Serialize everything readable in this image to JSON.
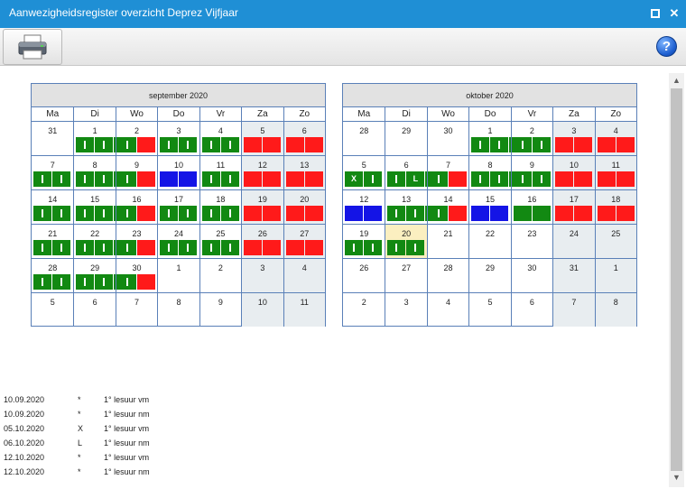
{
  "window": {
    "title": "Aanwezigheidsregister overzicht Deprez Vijfjaar",
    "close_label": "✕"
  },
  "toolbar": {
    "help_label": "?"
  },
  "day_headers": [
    "Ma",
    "Di",
    "Wo",
    "Do",
    "Vr",
    "Za",
    "Zo"
  ],
  "calendars": [
    {
      "title": "september 2020",
      "weeks": [
        [
          {
            "d": "31",
            "b": []
          },
          {
            "d": "1",
            "b": [
              "g",
              "g",
              "g"
            ]
          },
          {
            "d": "2",
            "b": [
              "g",
              "r"
            ]
          },
          {
            "d": "3",
            "b": [
              "g",
              "g"
            ]
          },
          {
            "d": "4",
            "b": [
              "g",
              "g"
            ]
          },
          {
            "d": "5",
            "w": 1,
            "b": [
              "r",
              "r"
            ]
          },
          {
            "d": "6",
            "w": 1,
            "b": [
              "r",
              "r"
            ]
          }
        ],
        [
          {
            "d": "7",
            "b": [
              "g",
              "g"
            ]
          },
          {
            "d": "8",
            "b": [
              "g",
              "g",
              "g"
            ]
          },
          {
            "d": "9",
            "b": [
              "g",
              "r"
            ]
          },
          {
            "d": "10",
            "b": [
              "b",
              "b"
            ]
          },
          {
            "d": "11",
            "b": [
              "g",
              "g"
            ]
          },
          {
            "d": "12",
            "w": 1,
            "b": [
              "r",
              "r"
            ]
          },
          {
            "d": "13",
            "w": 1,
            "b": [
              "r",
              "r"
            ]
          }
        ],
        [
          {
            "d": "14",
            "b": [
              "g",
              "g"
            ]
          },
          {
            "d": "15",
            "b": [
              "g",
              "g",
              "g"
            ]
          },
          {
            "d": "16",
            "b": [
              "g",
              "r"
            ]
          },
          {
            "d": "17",
            "b": [
              "g",
              "g"
            ]
          },
          {
            "d": "18",
            "b": [
              "g",
              "g"
            ]
          },
          {
            "d": "19",
            "w": 1,
            "b": [
              "r",
              "r"
            ]
          },
          {
            "d": "20",
            "w": 1,
            "b": [
              "r",
              "r"
            ]
          }
        ],
        [
          {
            "d": "21",
            "b": [
              "g",
              "g"
            ]
          },
          {
            "d": "22",
            "b": [
              "g",
              "g",
              "g"
            ]
          },
          {
            "d": "23",
            "b": [
              "g",
              "r"
            ]
          },
          {
            "d": "24",
            "b": [
              "g",
              "g"
            ]
          },
          {
            "d": "25",
            "b": [
              "g",
              "g"
            ]
          },
          {
            "d": "26",
            "w": 1,
            "b": [
              "r",
              "r"
            ]
          },
          {
            "d": "27",
            "w": 1,
            "b": [
              "r",
              "r"
            ]
          }
        ],
        [
          {
            "d": "28",
            "b": [
              "g",
              "g"
            ]
          },
          {
            "d": "29",
            "b": [
              "g",
              "g",
              "g"
            ]
          },
          {
            "d": "30",
            "b": [
              "g",
              "r"
            ]
          },
          {
            "d": "1",
            "b": []
          },
          {
            "d": "2",
            "b": []
          },
          {
            "d": "3",
            "w": 1,
            "b": []
          },
          {
            "d": "4",
            "w": 1,
            "b": []
          }
        ],
        [
          {
            "d": "5",
            "b": []
          },
          {
            "d": "6",
            "b": []
          },
          {
            "d": "7",
            "b": []
          },
          {
            "d": "8",
            "b": []
          },
          {
            "d": "9",
            "b": []
          },
          {
            "d": "10",
            "w": 1,
            "b": []
          },
          {
            "d": "11",
            "w": 1,
            "b": []
          }
        ]
      ]
    },
    {
      "title": "oktober 2020",
      "weeks": [
        [
          {
            "d": "28",
            "b": []
          },
          {
            "d": "29",
            "b": []
          },
          {
            "d": "30",
            "b": []
          },
          {
            "d": "1",
            "b": [
              "g",
              "g",
              "g"
            ]
          },
          {
            "d": "2",
            "b": [
              "g",
              "g"
            ]
          },
          {
            "d": "3",
            "w": 1,
            "b": [
              "r",
              "r"
            ]
          },
          {
            "d": "4",
            "w": 1,
            "b": [
              "r",
              "r"
            ]
          }
        ],
        [
          {
            "d": "5",
            "b": [
              "X",
              "g"
            ]
          },
          {
            "d": "6",
            "b": [
              "g",
              "L",
              "g"
            ]
          },
          {
            "d": "7",
            "b": [
              "g",
              "r"
            ]
          },
          {
            "d": "8",
            "b": [
              "g",
              "g",
              "g"
            ]
          },
          {
            "d": "9",
            "b": [
              "g",
              "g"
            ]
          },
          {
            "d": "10",
            "w": 1,
            "b": [
              "r",
              "r"
            ]
          },
          {
            "d": "11",
            "w": 1,
            "b": [
              "r",
              "r"
            ]
          }
        ],
        [
          {
            "d": "12",
            "b": [
              "b",
              "b"
            ]
          },
          {
            "d": "13",
            "b": [
              "g",
              "g",
              "g"
            ]
          },
          {
            "d": "14",
            "b": [
              "g",
              "r"
            ]
          },
          {
            "d": "15",
            "b": [
              "b",
              "b"
            ]
          },
          {
            "d": "16",
            "b": [
              "G",
              "G"
            ]
          },
          {
            "d": "17",
            "w": 1,
            "b": [
              "r",
              "r"
            ]
          },
          {
            "d": "18",
            "w": 1,
            "b": [
              "r",
              "r"
            ]
          }
        ],
        [
          {
            "d": "19",
            "b": [
              "g",
              "g"
            ]
          },
          {
            "d": "20",
            "t": 1,
            "b": [
              "g",
              "g"
            ]
          },
          {
            "d": "21",
            "b": []
          },
          {
            "d": "22",
            "b": []
          },
          {
            "d": "23",
            "b": []
          },
          {
            "d": "24",
            "w": 1,
            "b": []
          },
          {
            "d": "25",
            "w": 1,
            "b": []
          }
        ],
        [
          {
            "d": "26",
            "b": []
          },
          {
            "d": "27",
            "b": []
          },
          {
            "d": "28",
            "b": []
          },
          {
            "d": "29",
            "b": []
          },
          {
            "d": "30",
            "b": []
          },
          {
            "d": "31",
            "w": 1,
            "b": []
          },
          {
            "d": "1",
            "w": 1,
            "b": []
          }
        ],
        [
          {
            "d": "2",
            "b": []
          },
          {
            "d": "3",
            "b": []
          },
          {
            "d": "4",
            "b": []
          },
          {
            "d": "5",
            "b": []
          },
          {
            "d": "6",
            "b": []
          },
          {
            "d": "7",
            "w": 1,
            "b": []
          },
          {
            "d": "8",
            "w": 1,
            "b": []
          }
        ]
      ]
    }
  ],
  "status_colors": {
    "present": "#128912",
    "absent": "#ff1a1a",
    "other": "#1414e6",
    "weekend": "#e8edf0",
    "today": "#fbefc0"
  },
  "entries": [
    {
      "date": "10.09.2020",
      "code": "*",
      "desc": "1° lesuur vm"
    },
    {
      "date": "10.09.2020",
      "code": "*",
      "desc": "1° lesuur nm"
    },
    {
      "date": "05.10.2020",
      "code": "X",
      "desc": "1° lesuur vm"
    },
    {
      "date": "06.10.2020",
      "code": "L",
      "desc": "1° lesuur nm"
    },
    {
      "date": "12.10.2020",
      "code": "*",
      "desc": "1° lesuur vm"
    },
    {
      "date": "12.10.2020",
      "code": "*",
      "desc": "1° lesuur nm"
    }
  ]
}
